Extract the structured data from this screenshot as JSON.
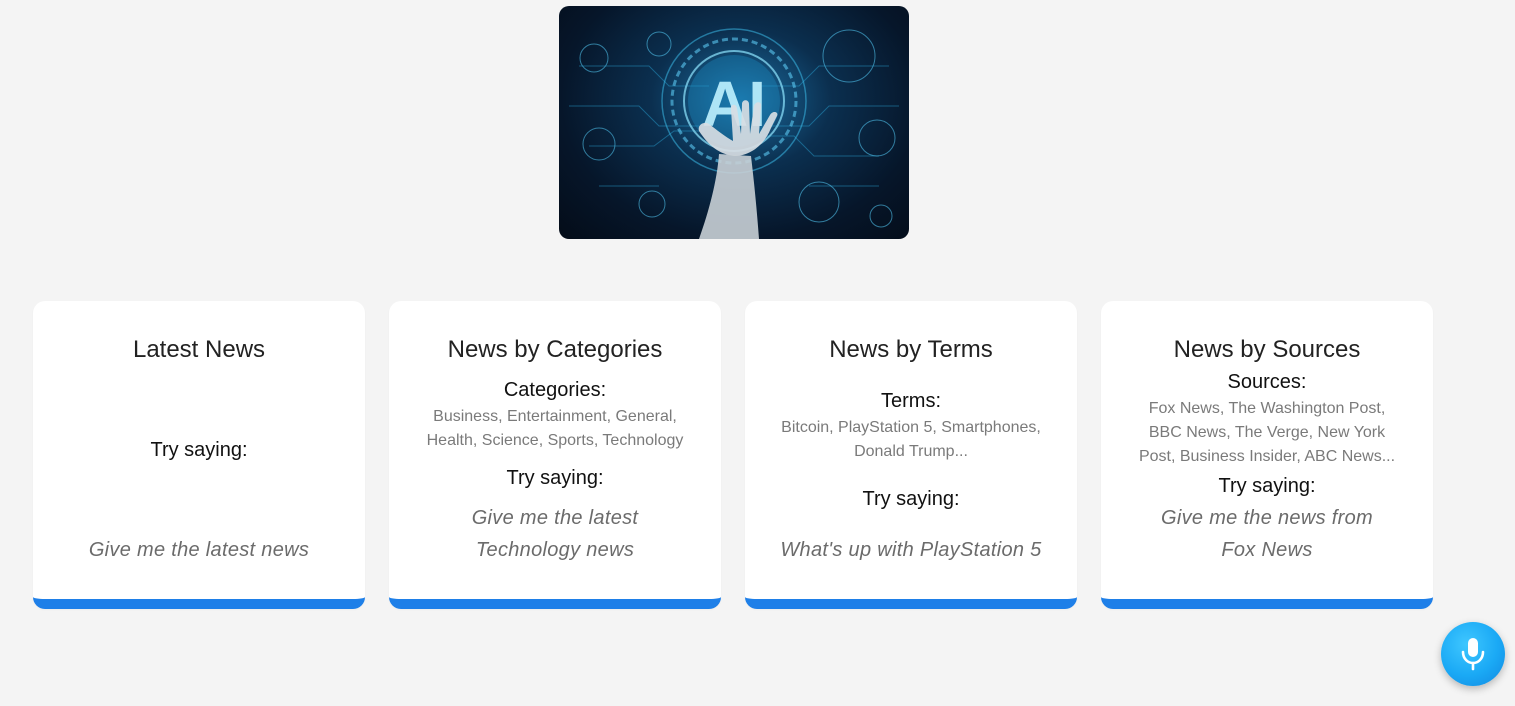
{
  "hero": {
    "badge_text": "AI",
    "alt": "AI"
  },
  "cards": [
    {
      "title": "Latest News",
      "try_label": "Try saying:",
      "example": "Give me the latest news"
    },
    {
      "title": "News by Categories",
      "list_label": "Categories:",
      "list_text": "Business, Entertainment, General, Health, Science, Sports, Technology",
      "try_label": "Try saying:",
      "example": "Give me the latest Technology news"
    },
    {
      "title": "News by Terms",
      "list_label": "Terms:",
      "list_text": "Bitcoin, PlayStation 5, Smartphones, Donald Trump...",
      "try_label": "Try saying:",
      "example": "What's up with PlayStation 5"
    },
    {
      "title": "News by Sources",
      "list_label": "Sources:",
      "list_text": "Fox News, The Washington Post, BBC News, The Verge, New York Post, Business Insider, ABC News...",
      "try_label": "Try saying:",
      "example": "Give me the news from Fox News"
    }
  ],
  "colors": {
    "accent": "#1e7fe8",
    "mic": "#1aa9f5",
    "background": "#f4f4f4"
  },
  "icons": {
    "mic": "microphone-icon"
  }
}
